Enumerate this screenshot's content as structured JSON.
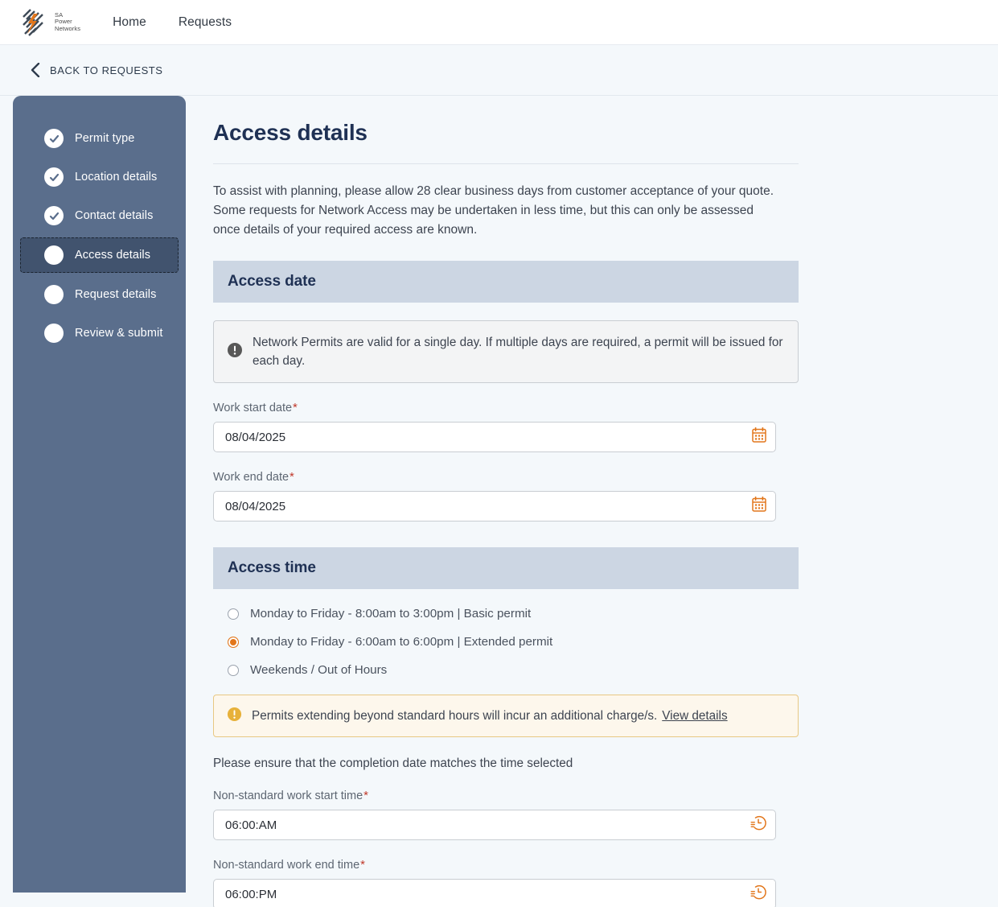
{
  "topnav": {
    "logo_alt": "SA Power Networks",
    "logo_lines": [
      "SA",
      "Power",
      "Networks"
    ],
    "links": [
      {
        "label": "Home"
      },
      {
        "label": "Requests"
      }
    ]
  },
  "backbar": {
    "label": "BACK TO REQUESTS",
    "icon": "chevron-left-icon"
  },
  "sidebar": {
    "steps": [
      {
        "label": "Permit type",
        "state": "complete"
      },
      {
        "label": "Location details",
        "state": "complete"
      },
      {
        "label": "Contact details",
        "state": "complete"
      },
      {
        "label": "Access details",
        "state": "active"
      },
      {
        "label": "Request details",
        "state": "pending"
      },
      {
        "label": "Review & submit",
        "state": "pending"
      }
    ]
  },
  "main": {
    "title": "Access details",
    "intro": "To assist with planning, please allow 28 clear business days from customer acceptance of your quote. Some requests for Network Access may be undertaken in less time, but this can only be assessed once details of your required access are known.",
    "access_date": {
      "heading": "Access date",
      "info_banner": {
        "icon": "info-exclamation-icon",
        "text": "Network Permits are valid for a single day. If multiple days are required, a permit will be issued for each day."
      },
      "start_date": {
        "label": "Work start date",
        "required_marker": "*",
        "value": "08/04/2025",
        "icon": "calendar-icon"
      },
      "end_date": {
        "label": "Work end date",
        "required_marker": "*",
        "value": "08/04/2025",
        "icon": "calendar-icon"
      }
    },
    "access_time": {
      "heading": "Access time",
      "options": [
        {
          "label": "Monday to Friday - 8:00am to 3:00pm | Basic permit",
          "selected": false
        },
        {
          "label": "Monday to Friday - 6:00am to 6:00pm | Extended permit",
          "selected": true
        },
        {
          "label": "Weekends / Out of Hours",
          "selected": false
        }
      ],
      "warn_banner": {
        "icon": "warning-exclamation-icon",
        "text": "Permits extending beyond standard hours will incur an additional charge/s.",
        "link_label": "View details"
      },
      "helper_text": "Please ensure that the completion date matches the time selected",
      "start_time": {
        "label": "Non-standard work start time",
        "required_marker": "*",
        "value": "06:00:AM",
        "icon": "clock-schedule-icon"
      },
      "end_time": {
        "label": "Non-standard work end time",
        "required_marker": "*",
        "value": "06:00:PM",
        "icon": "clock-schedule-icon"
      }
    }
  },
  "colors": {
    "sidebar_bg": "#5a6e8c",
    "sidebar_active_bg": "#41536e",
    "section_head_bg": "#ccd6e3",
    "accent_orange": "#e2761b",
    "title_navy": "#1f3154",
    "warn_amber": "#e7b13a",
    "required_red": "#c0392b",
    "page_bg": "#f4f8fb"
  }
}
